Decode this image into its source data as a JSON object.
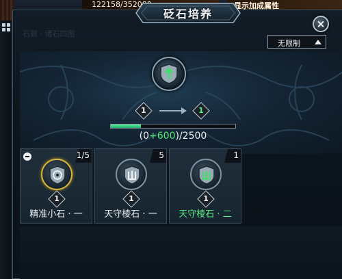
{
  "background": {
    "counter_text": "122158/352080",
    "right_label": "显示加成属性"
  },
  "dialog": {
    "title": "砭石培养",
    "close_label": "×",
    "ghost_text": "石碧 · 诸石四图"
  },
  "filter": {
    "selected": "无限制"
  },
  "upgrade": {
    "current_level": "1",
    "next_level": "1",
    "progress": {
      "current": 0,
      "added_display": "+600",
      "max": 2500,
      "prefix": "(0",
      "suffix": ")/2500",
      "fill_fraction": 0.24
    }
  },
  "colors": {
    "accent_green": "#53ee7a",
    "selected_gold": "#d6b43a"
  },
  "stones": [
    {
      "name": "精准小石 · 一",
      "count": "1/5",
      "level": "1",
      "icon": "target-shield-icon",
      "selected": true,
      "name_color": "default"
    },
    {
      "name": "天守棱石 · 一",
      "count": "5",
      "level": "1",
      "icon": "fist-shield-icon",
      "selected": false,
      "name_color": "default"
    },
    {
      "name": "天守棱石 · 二",
      "count": "1",
      "level": "1",
      "icon": "fist-shield-icon",
      "selected": false,
      "name_color": "green"
    }
  ]
}
